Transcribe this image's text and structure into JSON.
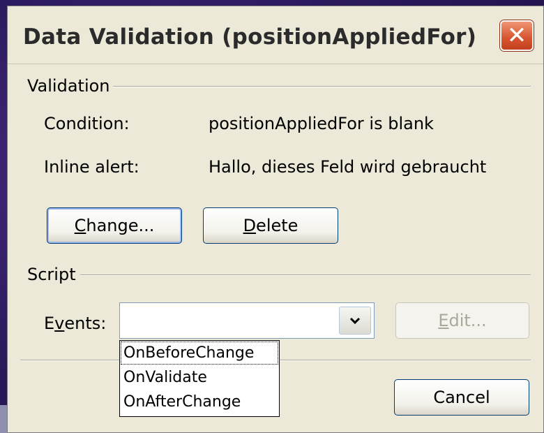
{
  "dialog": {
    "title": "Data Validation (positionAppliedFor)",
    "close_symbol": "✕"
  },
  "validation": {
    "group_label": "Validation",
    "condition_label": "Condition:",
    "condition_value": "positionAppliedFor is blank",
    "alert_label": "Inline alert:",
    "alert_value": "Hallo, dieses Feld wird gebraucht",
    "change_button": {
      "mnemonic": "C",
      "rest": "hange..."
    },
    "delete_button": {
      "mnemonic": "D",
      "rest": "elete"
    }
  },
  "script": {
    "group_label": "Script",
    "events_label": {
      "pre": "E",
      "mnemonic": "v",
      "post": "ents:"
    },
    "events_value": "",
    "edit_button": {
      "mnemonic": "E",
      "rest": "dit..."
    },
    "dropdown_options": [
      "OnBeforeChange",
      "OnValidate",
      "OnAfterChange"
    ]
  },
  "footer": {
    "cancel_button": "Cancel"
  },
  "icons": {
    "close": "close-icon",
    "dropdown_arrow": "chevron-down-icon"
  },
  "colors": {
    "dialog_bg": "#ece9d8",
    "close_button": "#d7542f",
    "button_border": "#003c74"
  }
}
